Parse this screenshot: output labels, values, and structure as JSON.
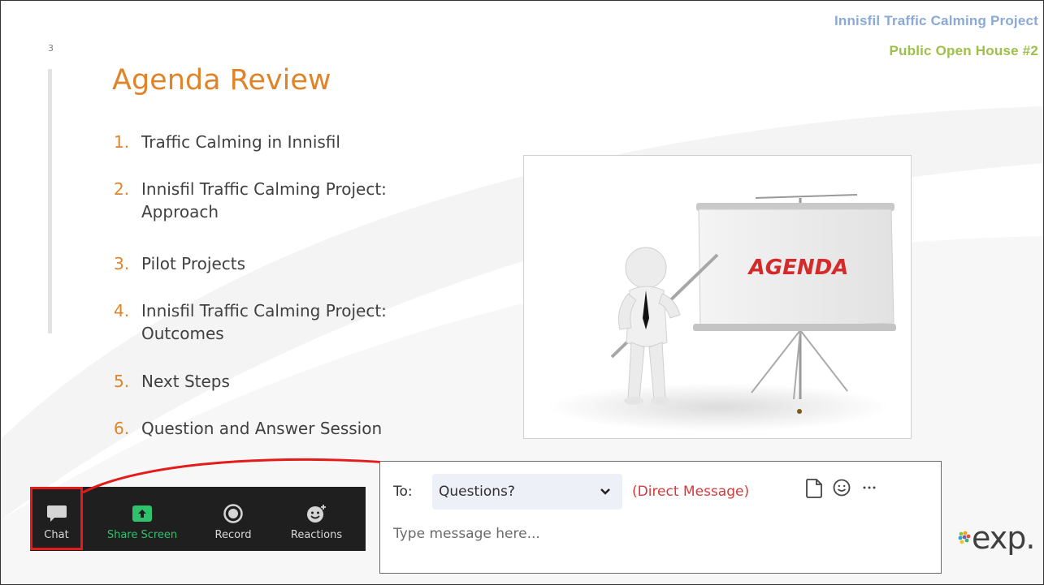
{
  "slide": {
    "number": "3",
    "header_title": "Innisfil Traffic Calming Project",
    "header_subtitle": "Public Open House #2",
    "title": "Agenda Review"
  },
  "agenda": {
    "items": [
      {
        "num": "1.",
        "text": "Traffic Calming in Innisfil"
      },
      {
        "num": "2.",
        "text": "Innisfil Traffic Calming Project: Approach"
      },
      {
        "num": "3.",
        "text": "Pilot Projects"
      },
      {
        "num": "4.",
        "text": "Innisfil Traffic Calming Project: Outcomes"
      },
      {
        "num": "5.",
        "text": "Next Steps"
      },
      {
        "num": "6.",
        "text": "Question and Answer Session"
      }
    ]
  },
  "picture": {
    "board_text": "AGENDA"
  },
  "toolbar": {
    "chat_label": "Chat",
    "share_label": "Share Screen",
    "record_label": "Record",
    "reactions_label": "Reactions"
  },
  "chat_panel": {
    "to_label": "To:",
    "recipient": "Questions?",
    "direct_message_label": "(Direct Message)",
    "message_placeholder": "Type message here..."
  },
  "logo": {
    "text": "exp."
  },
  "colors": {
    "accent_orange": "#e0842a",
    "header_blue": "#8aa9d6",
    "header_green": "#9dc04a",
    "highlight_red": "#e31b1b",
    "share_green": "#2dc26b",
    "toolbar_bg": "#1f1f1f"
  }
}
